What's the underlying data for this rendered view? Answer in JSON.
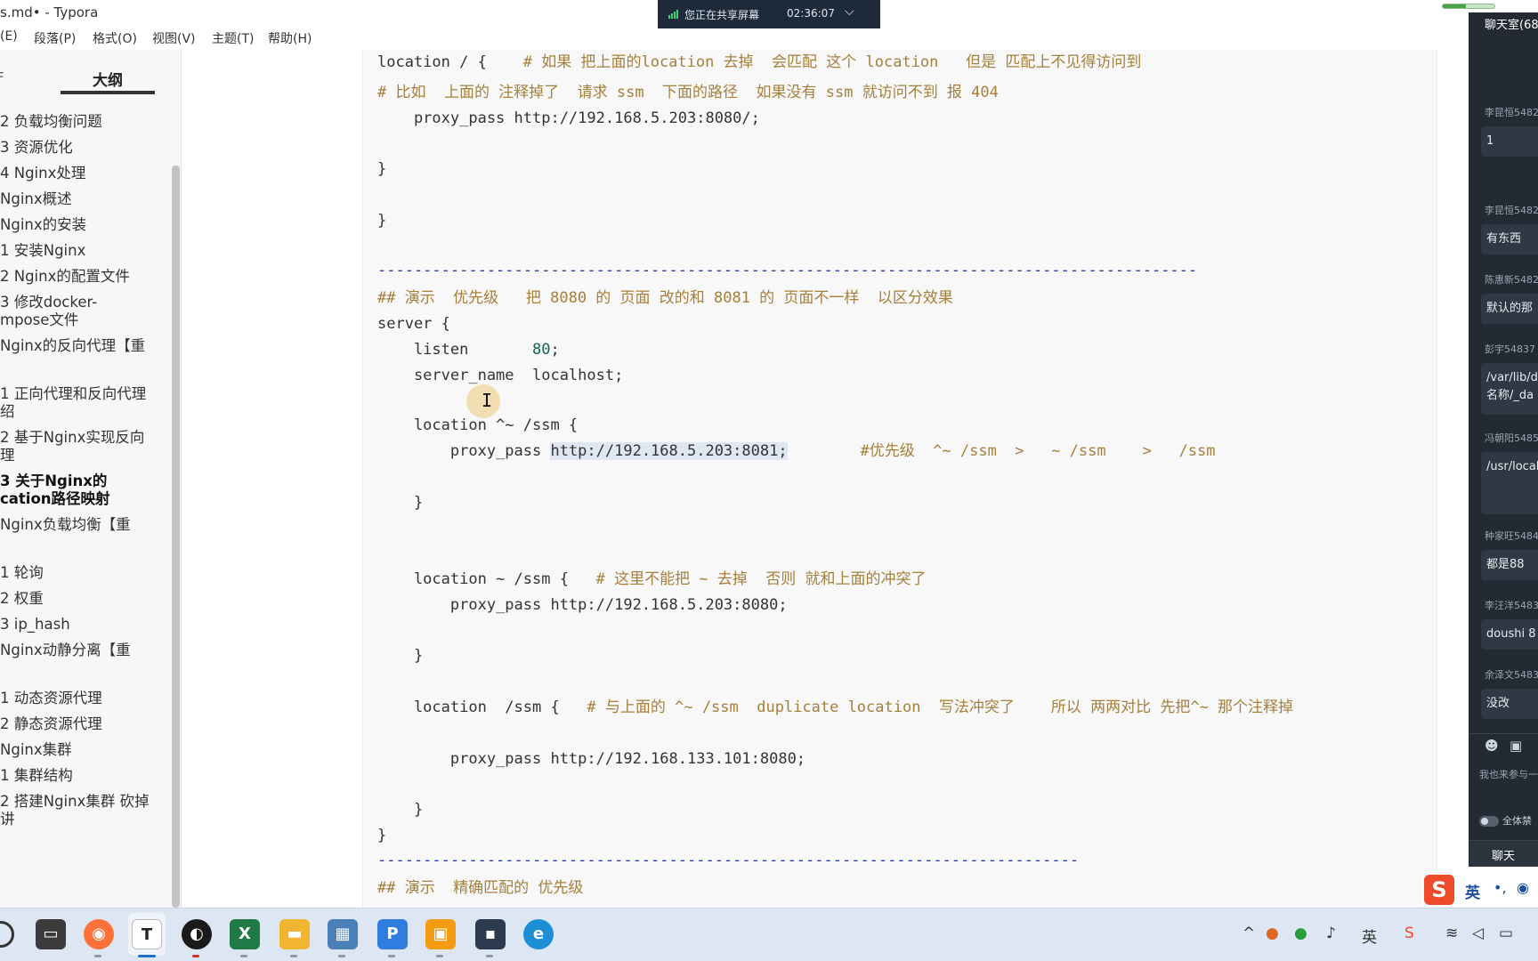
{
  "window": {
    "title": "s.md• - Typora",
    "share_banner": {
      "text": "您正在共享屏幕",
      "time": "02:36:07",
      "chevron": "⌵"
    }
  },
  "menu": [
    "(E)",
    "段落(P)",
    "格式(O)",
    "视图(V)",
    "主题(T)",
    "帮助(H)"
  ],
  "sidebar": {
    "tab_files": "F",
    "tab_outline": "大纲",
    "items": [
      {
        "label": "2 负载均衡问题",
        "bold": false
      },
      {
        "label": "3 资源优化",
        "bold": false
      },
      {
        "label": "4 Nginx处理",
        "bold": false
      },
      {
        "label": "Nginx概述",
        "bold": false
      },
      {
        "label": "Nginx的安装",
        "bold": false
      },
      {
        "label": "1 安装Nginx",
        "bold": false
      },
      {
        "label": "2 Nginx的配置文件",
        "bold": false
      },
      {
        "label": "3 修改docker-",
        "bold": false
      },
      {
        "label": "mpose文件",
        "bold": false
      },
      {
        "label": "Nginx的反向代理【重",
        "bold": false
      },
      {
        "label": "1 正向代理和反向代理",
        "bold": false
      },
      {
        "label": "绍",
        "bold": false
      },
      {
        "label": "2 基于Nginx实现反向",
        "bold": false
      },
      {
        "label": "理",
        "bold": false
      },
      {
        "label": "3 关于Nginx的",
        "bold": true
      },
      {
        "label": "cation路径映射",
        "bold": true
      },
      {
        "label": "Nginx负载均衡【重",
        "bold": false
      },
      {
        "label": "1 轮询",
        "bold": false
      },
      {
        "label": "2 权重",
        "bold": false
      },
      {
        "label": "3 ip_hash",
        "bold": false
      },
      {
        "label": "Nginx动静分离【重",
        "bold": false
      },
      {
        "label": "1 动态资源代理",
        "bold": false
      },
      {
        "label": "2 静态资源代理",
        "bold": false
      },
      {
        "label": "Nginx集群",
        "bold": false
      },
      {
        "label": "1 集群结构",
        "bold": false
      },
      {
        "label": "2 搭建Nginx集群 砍掉",
        "bold": false
      },
      {
        "label": "讲",
        "bold": false
      }
    ],
    "footer_left": "<",
    "footer_src": "</>"
  },
  "code": {
    "l1_a": "location / {    ",
    "l1_c": "# 如果 把上面的location 去掉  会匹配 这个 location   但是 匹配上不见得访问到",
    "l2_c": "# 比如  上面的 注释掉了  请求 ssm  下面的路径  如果没有 ssm 就访问不到 报 404",
    "l3": "    proxy_pass http://192.168.5.203:8080/;",
    "l4": "}",
    "l5": "}",
    "divider1": "------------------------------------------------------------------------------------------",
    "l6_c": "## 演示  优先级   把 8080 的 页面 改的和 8081 的 页面不一样  以区分效果",
    "l7": "server {",
    "l8_a": "    listen       ",
    "l8_n": "80",
    "l8_b": ";",
    "l9": "    server_name  localhost;",
    "l10": "    location ^~ /ssm {",
    "l11_a": "        proxy_pass ",
    "l11_hl": "http://192.168.5.203:8081;",
    "l11_c": "        #优先级  ^~ /ssm  >   ~ /ssm    >   /ssm",
    "l12": "    }",
    "l13_a": "    location ~ /ssm {   ",
    "l13_c": "# 这里不能把 ~ 去掉  否则 就和上面的冲突了",
    "l14": "        proxy_pass http://192.168.5.203:8080;",
    "l15": "    }",
    "l16_a": "    location  /ssm {   ",
    "l16_c": "# 与上面的 ^~ /ssm  duplicate location  写法冲突了    所以 两两对比 先把^~ 那个注释掉",
    "l17": "        proxy_pass http://192.168.133.101:8080;",
    "l18": "    }",
    "l19": "}",
    "divider2": "-----------------------------------------------------------------------------",
    "l20_c": "## 演示  精确匹配的 优先级"
  },
  "chat": {
    "title": "聊天室(68",
    "messages": [
      {
        "sender": "李昆恒5482",
        "text": "1"
      },
      {
        "sender": "李昆恒5482",
        "text": "有东西"
      },
      {
        "sender": "陈惠新5482",
        "text": "默认的那"
      },
      {
        "sender": "彭宇54837",
        "text": "/var/lib/d"
      },
      {
        "sender": "冯朝阳5485",
        "text": "/usr/local"
      },
      {
        "sender": "种家旺5484",
        "text": "都是88"
      },
      {
        "sender": "李汪洋5483",
        "text": "doushi 8"
      },
      {
        "sender": "余泽文5483",
        "text": "没改"
      }
    ],
    "bubble_extra": "名称/_da",
    "hint": "我也来参与一下",
    "mute_label": "全体禁",
    "chat_button": "聊天"
  },
  "ime": {
    "logo": "S",
    "lang": "英",
    "punc": "•,",
    "mic": "🎤"
  },
  "colors": {
    "comment": "#a67f3b",
    "divider": "#2a3aa8",
    "code_bg": "#f8f8f8",
    "sidebar_bg": "#f7f7f7",
    "taskbar_bg": "#dde6f3"
  }
}
